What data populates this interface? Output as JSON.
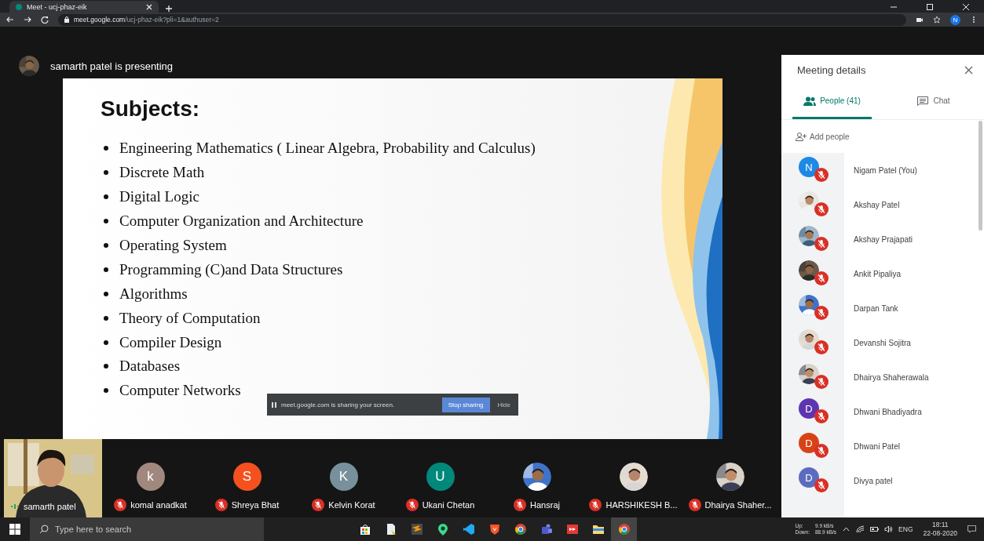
{
  "browser": {
    "tab_title": "Meet - ucj-phaz-eik",
    "url_host": "meet.google.com",
    "url_path": "/ucj-phaz-eik?pli=1&authuser=2",
    "profile_initial": "N"
  },
  "presenter": {
    "text": "samarth patel is presenting"
  },
  "slide": {
    "title": "Subjects:",
    "bullets": [
      "Engineering Mathematics ( Linear Algebra,  Probability and Calculus)",
      "Discrete Math",
      "Digital Logic",
      "Computer Organization and Architecture",
      "Operating System",
      "Programming (C)and Data Structures",
      "Algorithms",
      "Theory of Computation",
      "Compiler Design",
      "Databases",
      "Computer Networks"
    ]
  },
  "share_banner": {
    "message": "meet.google.com is sharing your screen.",
    "stop_button": "Stop sharing",
    "hide_button": "Hide"
  },
  "tiles": [
    {
      "name": "samarth patel",
      "kind": "video",
      "muted": false
    },
    {
      "name": "komal anadkat",
      "kind": "letter",
      "letter": "k",
      "color": "#a1887f",
      "muted": true
    },
    {
      "name": "Shreya Bhat",
      "kind": "letter",
      "letter": "S",
      "color": "#f4511e",
      "muted": true
    },
    {
      "name": "Kelvin Korat",
      "kind": "letter",
      "letter": "K",
      "color": "#78909c",
      "muted": true
    },
    {
      "name": "Ukani Chetan",
      "kind": "letter",
      "letter": "U",
      "color": "#00897b",
      "muted": true
    },
    {
      "name": "Hansraj",
      "muted": true
    },
    {
      "name": "HARSHIKESH B...",
      "muted": true
    },
    {
      "name": "Dhairya Shaher...",
      "muted": true
    }
  ],
  "panel": {
    "title": "Meeting details",
    "tabs": [
      {
        "label": "People (41)",
        "kind": "people",
        "selected": true
      },
      {
        "label": "Chat",
        "kind": "chat",
        "selected": false
      }
    ],
    "add_people": "Add people",
    "people": [
      {
        "name": "Nigam Patel (You)",
        "kind": "letter",
        "letter": "N",
        "color": "#1e88e5",
        "muted": true
      },
      {
        "name": "Akshay Patel",
        "muted": true
      },
      {
        "name": "Akshay Prajapati",
        "muted": true
      },
      {
        "name": "Ankit Pipaliya",
        "muted": true
      },
      {
        "name": "Darpan Tank",
        "muted": true
      },
      {
        "name": "Devanshi Sojitra",
        "muted": true
      },
      {
        "name": "Dhairya Shaherawala",
        "muted": true
      },
      {
        "name": "Dhwani Bhadiyadra",
        "kind": "letter",
        "letter": "D",
        "color": "#5e35b1",
        "muted": true
      },
      {
        "name": "Dhwani Patel",
        "kind": "letter",
        "letter": "D",
        "color": "#d84315",
        "muted": true
      },
      {
        "name": "Divya patel",
        "kind": "letter",
        "letter": "D",
        "color": "#5c6bc0",
        "muted": true
      }
    ]
  },
  "taskbar": {
    "search_placeholder": "Type here to search",
    "net_up_label": "Up:",
    "net_down_label": "Down:",
    "net_up": "9.9 kB/s",
    "net_down": "88.9 kB/s",
    "language": "ENG",
    "time": "18:11",
    "date": "22-08-2020"
  }
}
